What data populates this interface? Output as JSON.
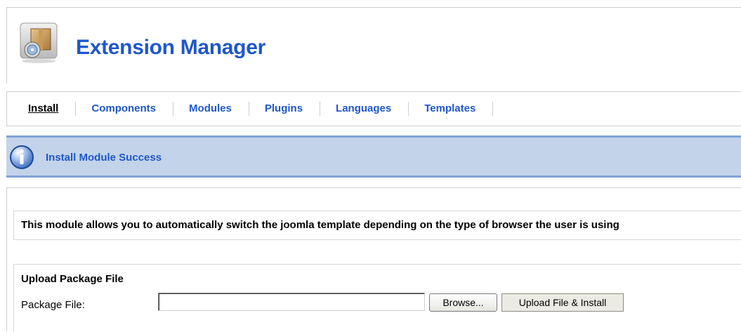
{
  "header": {
    "title": "Extension Manager",
    "icon": "package-install-icon"
  },
  "tabs": [
    {
      "label": "Install",
      "active": true
    },
    {
      "label": "Components",
      "active": false
    },
    {
      "label": "Modules",
      "active": false
    },
    {
      "label": "Plugins",
      "active": false
    },
    {
      "label": "Languages",
      "active": false
    },
    {
      "label": "Templates",
      "active": false
    }
  ],
  "message": {
    "icon": "info-icon",
    "text": "Install Module Success"
  },
  "description": {
    "text": "This module allows you to automatically switch the joomla template depending on the type of browser the user is using"
  },
  "upload": {
    "title": "Upload Package File",
    "field_label": "Package File:",
    "field_value": "",
    "browse_label": "Browse...",
    "submit_label": "Upload File & Install"
  },
  "colors": {
    "accent": "#1f57c9",
    "message_bg": "#c3d3ea",
    "message_border": "#7fa2d4"
  }
}
